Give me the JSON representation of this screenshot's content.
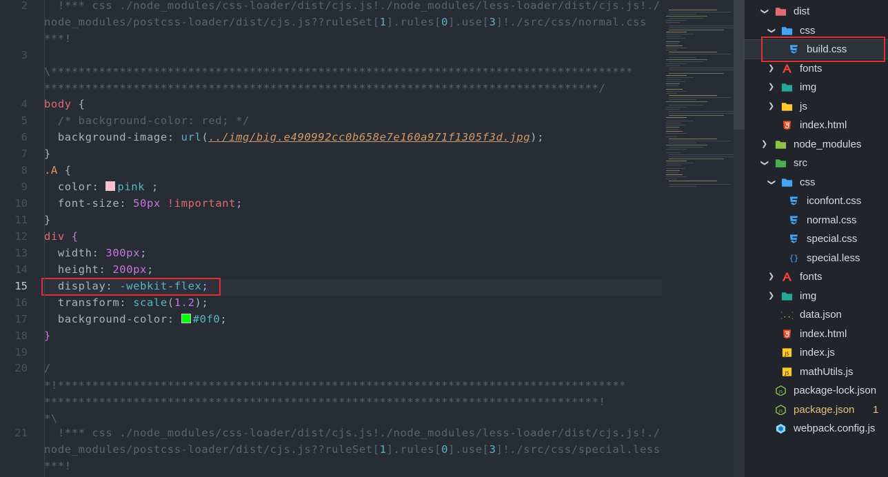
{
  "editor": {
    "lines": [
      {
        "n": "2",
        "parts": [
          {
            "t": "  !*** css ./node_modules/css-loader/dist/cjs.js!./node_modules/less-loader/dist/cjs.js!./",
            "c": "pale"
          }
        ]
      },
      {
        "n": "",
        "parts": [
          {
            "t": "node_modules/postcss-loader/dist/cjs.js??ruleSet[",
            "c": "pale"
          },
          {
            "t": "1",
            "c": "fn"
          },
          {
            "t": "].rules[",
            "c": "pale"
          },
          {
            "t": "0",
            "c": "fn"
          },
          {
            "t": "].use[",
            "c": "pale"
          },
          {
            "t": "3",
            "c": "fn"
          },
          {
            "t": "]!./src/css/normal.css",
            "c": "pale"
          }
        ]
      },
      {
        "n": "",
        "parts": [
          {
            "t": "***!",
            "c": "pale"
          }
        ]
      },
      {
        "n": "3",
        "parts": []
      },
      {
        "n": "",
        "parts": [
          {
            "t": "\\*************************************************************************************",
            "c": "pale"
          }
        ]
      },
      {
        "n": "",
        "parts": [
          {
            "t": "*********************************************************************************/",
            "c": "pale"
          }
        ]
      },
      {
        "n": "4",
        "parts": [
          {
            "t": "body",
            "c": "sel"
          },
          {
            "t": " {",
            "c": "prop"
          }
        ]
      },
      {
        "n": "5",
        "parts": [
          {
            "t": "  /* background-color: red; */",
            "c": "cm"
          }
        ]
      },
      {
        "n": "6",
        "parts": [
          {
            "t": "  background-image: ",
            "c": "prop"
          },
          {
            "t": "url",
            "c": "fn"
          },
          {
            "t": "(",
            "c": "prop"
          },
          {
            "t": "../img/big.e490992cc0b658e7e160a971f1305f3d.jpg",
            "c": "str"
          },
          {
            "t": ");",
            "c": "prop"
          }
        ]
      },
      {
        "n": "7",
        "parts": [
          {
            "t": "}",
            "c": "prop"
          }
        ]
      },
      {
        "n": "8",
        "parts": [
          {
            "t": ".A",
            "c": "cls"
          },
          {
            "t": " {",
            "c": "prop"
          }
        ]
      },
      {
        "n": "9",
        "parts": [
          {
            "t": "  color: ",
            "c": "prop"
          },
          {
            "t": "■",
            "c": "swatch-pink"
          },
          {
            "t": "pink",
            "c": "fn"
          },
          {
            "t": " ;",
            "c": "prop"
          }
        ]
      },
      {
        "n": "10",
        "parts": [
          {
            "t": "  font-size: ",
            "c": "prop"
          },
          {
            "t": "50px",
            "c": "num"
          },
          {
            "t": " ",
            "c": "prop"
          },
          {
            "t": "!important",
            "c": "sel"
          },
          {
            "t": ";",
            "c": "prop"
          }
        ]
      },
      {
        "n": "11",
        "parts": [
          {
            "t": "}",
            "c": "prop"
          }
        ]
      },
      {
        "n": "12",
        "parts": [
          {
            "t": "div",
            "c": "sel"
          },
          {
            "t": " ",
            "c": "prop"
          },
          {
            "t": "{",
            "c": "brk"
          }
        ]
      },
      {
        "n": "13",
        "parts": [
          {
            "t": "  width: ",
            "c": "prop"
          },
          {
            "t": "300px",
            "c": "num"
          },
          {
            "t": ";",
            "c": "prop"
          }
        ]
      },
      {
        "n": "14",
        "parts": [
          {
            "t": "  height: ",
            "c": "prop"
          },
          {
            "t": "200px",
            "c": "num"
          },
          {
            "t": ";",
            "c": "prop"
          }
        ]
      },
      {
        "n": "15",
        "parts": [
          {
            "t": "  display: ",
            "c": "prop"
          },
          {
            "t": "-webkit-flex",
            "c": "fn"
          },
          {
            "t": ";",
            "c": "prop"
          }
        ]
      },
      {
        "n": "16",
        "parts": [
          {
            "t": "  transform: ",
            "c": "prop"
          },
          {
            "t": "scale",
            "c": "fn"
          },
          {
            "t": "(",
            "c": "prop"
          },
          {
            "t": "1.2",
            "c": "num"
          },
          {
            "t": ");",
            "c": "prop"
          }
        ]
      },
      {
        "n": "17",
        "parts": [
          {
            "t": "  background-color: ",
            "c": "prop"
          },
          {
            "t": "■",
            "c": "swatch-green"
          },
          {
            "t": "#0f0",
            "c": "fn"
          },
          {
            "t": ";",
            "c": "prop"
          }
        ]
      },
      {
        "n": "18",
        "parts": [
          {
            "t": "}",
            "c": "brk"
          }
        ]
      },
      {
        "n": "19",
        "parts": []
      },
      {
        "n": "20",
        "parts": [
          {
            "t": "/",
            "c": "pale"
          }
        ]
      },
      {
        "n": "",
        "parts": [
          {
            "t": "*!***********************************************************************************",
            "c": "pale"
          }
        ]
      },
      {
        "n": "",
        "parts": [
          {
            "t": "*********************************************************************************!",
            "c": "pale"
          }
        ]
      },
      {
        "n": "",
        "parts": [
          {
            "t": "*\\",
            "c": "pale"
          }
        ]
      },
      {
        "n": "21",
        "parts": [
          {
            "t": "  !*** css ./node_modules/css-loader/dist/cjs.js!./node_modules/less-loader/dist/cjs.js!./",
            "c": "pale"
          }
        ]
      },
      {
        "n": "",
        "parts": [
          {
            "t": "node_modules/postcss-loader/dist/cjs.js??ruleSet[",
            "c": "pale"
          },
          {
            "t": "1",
            "c": "fn"
          },
          {
            "t": "].rules[",
            "c": "pale"
          },
          {
            "t": "0",
            "c": "fn"
          },
          {
            "t": "].use[",
            "c": "pale"
          },
          {
            "t": "3",
            "c": "fn"
          },
          {
            "t": "]!./src/css/special.less",
            "c": "pale"
          }
        ]
      },
      {
        "n": "",
        "parts": [
          {
            "t": "***!",
            "c": "pale"
          }
        ]
      }
    ],
    "current_line": "15",
    "colors": {
      "pink": "#ffc0cb",
      "green": "#00ff00",
      "highlight": "#e03131"
    }
  },
  "explorer": {
    "items": [
      {
        "label": "dist",
        "indent": 0,
        "chev": "open",
        "icon": "folder-dist-icon",
        "color": "#e06c75"
      },
      {
        "label": "css",
        "indent": 1,
        "chev": "open",
        "icon": "folder-css-icon",
        "color": "#42a5f5"
      },
      {
        "label": "build.css",
        "indent": 2,
        "chev": "",
        "icon": "css-file-icon",
        "color": "#42a5f5",
        "active": true
      },
      {
        "label": "fonts",
        "indent": 1,
        "chev": "closed",
        "icon": "font-icon",
        "color": "#f44336"
      },
      {
        "label": "img",
        "indent": 1,
        "chev": "closed",
        "icon": "folder-img-icon",
        "color": "#26a69a"
      },
      {
        "label": "js",
        "indent": 1,
        "chev": "closed",
        "icon": "folder-js-icon",
        "color": "#ffca28"
      },
      {
        "label": "index.html",
        "indent": 1,
        "chev": "",
        "icon": "html-file-icon",
        "color": "#e44d26"
      },
      {
        "label": "node_modules",
        "indent": 0,
        "chev": "closed",
        "icon": "folder-node-icon",
        "color": "#8bc34a"
      },
      {
        "label": "src",
        "indent": 0,
        "chev": "open",
        "icon": "folder-src-icon",
        "color": "#4caf50"
      },
      {
        "label": "css",
        "indent": 1,
        "chev": "open",
        "icon": "folder-css-icon",
        "color": "#42a5f5"
      },
      {
        "label": "iconfont.css",
        "indent": 2,
        "chev": "",
        "icon": "css-file-icon",
        "color": "#42a5f5"
      },
      {
        "label": "normal.css",
        "indent": 2,
        "chev": "",
        "icon": "css-file-icon",
        "color": "#42a5f5"
      },
      {
        "label": "special.css",
        "indent": 2,
        "chev": "",
        "icon": "css-file-icon",
        "color": "#42a5f5"
      },
      {
        "label": "special.less",
        "indent": 2,
        "chev": "",
        "icon": "less-file-icon",
        "color": "#42a5f5"
      },
      {
        "label": "fonts",
        "indent": 1,
        "chev": "closed",
        "icon": "font-icon",
        "color": "#f44336"
      },
      {
        "label": "img",
        "indent": 1,
        "chev": "closed",
        "icon": "folder-img-icon",
        "color": "#26a69a"
      },
      {
        "label": "data.json",
        "indent": 1,
        "chev": "",
        "icon": "json-file-icon",
        "color": "#fbc02d"
      },
      {
        "label": "index.html",
        "indent": 1,
        "chev": "",
        "icon": "html-file-icon",
        "color": "#e44d26"
      },
      {
        "label": "index.js",
        "indent": 1,
        "chev": "",
        "icon": "js-file-icon",
        "color": "#ffca28"
      },
      {
        "label": "mathUtils.js",
        "indent": 1,
        "chev": "",
        "icon": "js-file-icon",
        "color": "#ffca28"
      },
      {
        "label": "package-lock.json",
        "indent": 0,
        "chev": "",
        "icon": "nodejs-file-icon",
        "color": "#8bc34a"
      },
      {
        "label": "package.json",
        "indent": 0,
        "chev": "",
        "icon": "nodejs-file-icon",
        "color": "#8bc34a",
        "modified": true,
        "badge": "1"
      },
      {
        "label": "webpack.config.js",
        "indent": 0,
        "chev": "",
        "icon": "webpack-file-icon",
        "color": "#8ed6fb"
      }
    ]
  }
}
